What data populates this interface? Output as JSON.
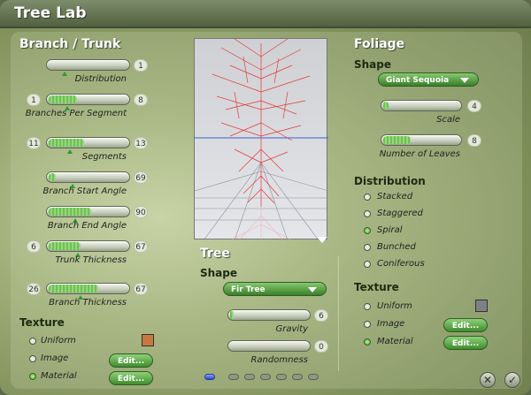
{
  "window": {
    "title": "Tree Lab"
  },
  "branch": {
    "heading": "Branch / Trunk",
    "sliders": [
      {
        "label": "Distribution",
        "min": "",
        "max": "1",
        "fill": 0.0
      },
      {
        "label": "Branches Per Segment",
        "min": "1",
        "max": "8",
        "fill": 0.4
      },
      {
        "label": "Segments",
        "min": "11",
        "max": "13",
        "fill": 0.5
      },
      {
        "label": "Branch Start Angle",
        "min": "",
        "max": "69",
        "fill": 0.1
      },
      {
        "label": "Branch End Angle",
        "min": "",
        "max": "90",
        "fill": 0.6
      },
      {
        "label": "Trunk Thickness",
        "min": "6",
        "max": "67",
        "fill": 0.45
      },
      {
        "label": "Branch Thickness",
        "min": "26",
        "max": "67",
        "fill": 0.7
      }
    ],
    "texture": {
      "heading": "Texture",
      "options": [
        {
          "label": "Uniform",
          "selected": false
        },
        {
          "label": "Image",
          "selected": false
        },
        {
          "label": "Material",
          "selected": true
        }
      ],
      "edit_label": "Edit...",
      "swatch_color": "#c7783f"
    }
  },
  "preview": {
    "expand_icon": "triangle-down-icon"
  },
  "tree": {
    "heading": "Tree",
    "shape_heading": "Shape",
    "shape_value": "Fir Tree",
    "sliders": [
      {
        "label": "Gravity",
        "max": "6",
        "fill": 0.05
      },
      {
        "label": "Randomness",
        "max": "0",
        "fill": 0.0
      }
    ]
  },
  "foliage": {
    "heading": "Foliage",
    "shape_heading": "Shape",
    "shape_value": "Giant Sequoia",
    "sliders": [
      {
        "label": "Scale",
        "max": "4",
        "fill": 0.08
      },
      {
        "label": "Number of Leaves",
        "max": "8",
        "fill": 0.4
      }
    ],
    "distribution": {
      "heading": "Distribution",
      "options": [
        {
          "label": "Stacked",
          "selected": false
        },
        {
          "label": "Staggered",
          "selected": false
        },
        {
          "label": "Spiral",
          "selected": true
        },
        {
          "label": "Bunched",
          "selected": false
        },
        {
          "label": "Coniferous",
          "selected": false
        }
      ]
    },
    "texture": {
      "heading": "Texture",
      "options": [
        {
          "label": "Uniform",
          "selected": false
        },
        {
          "label": "Image",
          "selected": false
        },
        {
          "label": "Material",
          "selected": true
        }
      ],
      "edit_label": "Edit...",
      "swatch_color": "#7f8087"
    }
  },
  "footer": {
    "close_label": "✕",
    "ok_label": "✓"
  }
}
